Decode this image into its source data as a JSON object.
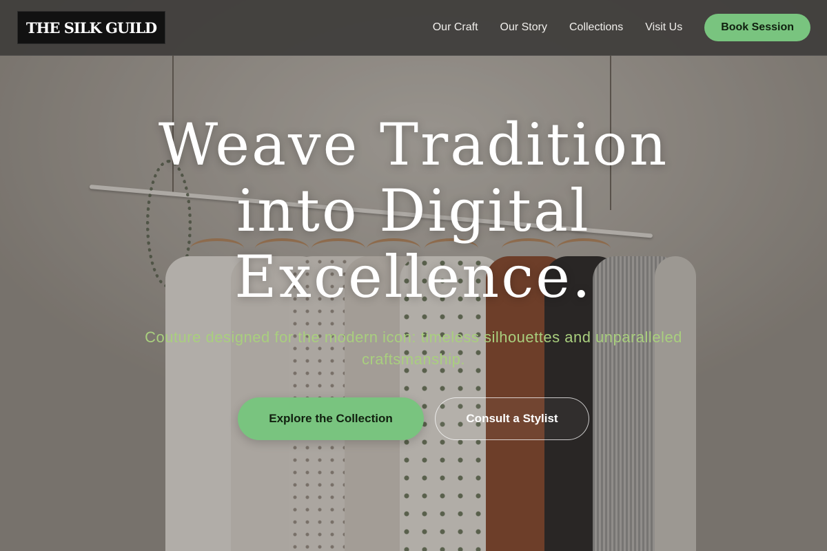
{
  "brand": {
    "logo_text": "THE SILK GUILD"
  },
  "nav": {
    "items": [
      {
        "label": "Our Craft"
      },
      {
        "label": "Our Story"
      },
      {
        "label": "Collections"
      },
      {
        "label": "Visit Us"
      }
    ],
    "cta_label": "Book Session"
  },
  "hero": {
    "headline_lines": [
      "Weave Tradition",
      "into Digital",
      "Excellence."
    ],
    "subtitle": "Couture designed for the modern icon: timeless silhouettes and unparalleled craftsmanship.",
    "primary_cta": "Explore the Collection",
    "secondary_cta": "Consult a Stylist"
  },
  "colors": {
    "accent_green": "#79c47f",
    "subtitle_green": "#a9cf7e",
    "header_bg": "#403e3c",
    "logo_bg": "#111111"
  }
}
